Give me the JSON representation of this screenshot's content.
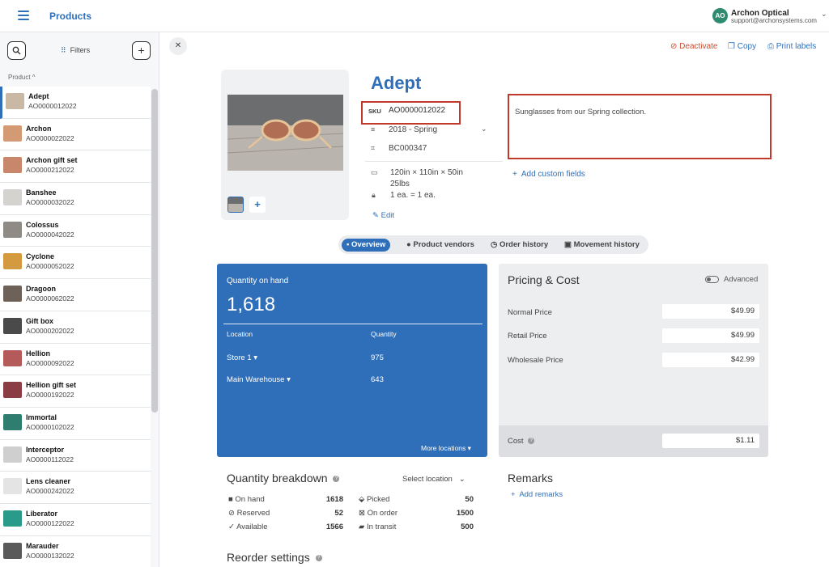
{
  "topbar": {
    "title": "Products",
    "avatar_initials": "AO",
    "company_name": "Archon Optical",
    "company_email": "support@archonsystems.com"
  },
  "sidebar": {
    "filters_label": "Filters",
    "sort_label": "Product ^",
    "items": [
      {
        "name": "Adept",
        "code": "AO0000012022",
        "thumb_color": "#c9b8a4"
      },
      {
        "name": "Archon",
        "code": "AO0000022022",
        "thumb_color": "#d49a74"
      },
      {
        "name": "Archon gift set",
        "code": "AO0000212022",
        "thumb_color": "#c8876a"
      },
      {
        "name": "Banshee",
        "code": "AO0000032022",
        "thumb_color": "#d5d3d0"
      },
      {
        "name": "Colossus",
        "code": "AO0000042022",
        "thumb_color": "#8e8a85"
      },
      {
        "name": "Cyclone",
        "code": "AO0000052022",
        "thumb_color": "#d49a40"
      },
      {
        "name": "Dragoon",
        "code": "AO0000062022",
        "thumb_color": "#6e6258"
      },
      {
        "name": "Gift box",
        "code": "AO0000202022",
        "thumb_color": "#4a4a4a"
      },
      {
        "name": "Hellion",
        "code": "AO0000092022",
        "thumb_color": "#b55a5a"
      },
      {
        "name": "Hellion gift set",
        "code": "AO0000192022",
        "thumb_color": "#8a3d45"
      },
      {
        "name": "Immortal",
        "code": "AO0000102022",
        "thumb_color": "#2e7d6f"
      },
      {
        "name": "Interceptor",
        "code": "AO0000112022",
        "thumb_color": "#cfcfcf"
      },
      {
        "name": "Lens cleaner",
        "code": "AO0000242022",
        "thumb_color": "#e4e4e4"
      },
      {
        "name": "Liberator",
        "code": "AO0000122022",
        "thumb_color": "#2a9a8a"
      },
      {
        "name": "Marauder",
        "code": "AO0000132022",
        "thumb_color": "#5a5a5a"
      }
    ]
  },
  "actions": {
    "deactivate": "Deactivate",
    "copy": "Copy",
    "print_labels": "Print labels"
  },
  "product": {
    "title": "Adept",
    "sku_label": "SKU",
    "sku": "AO0000012022",
    "season": "2018 - Spring",
    "barcode": "BC000347",
    "dimensions": "120in × 110in × 50in",
    "weight": "25lbs",
    "uom": "1 ea. = 1 ea.",
    "edit_label": "Edit",
    "description": "Sunglasses from our Spring collection.",
    "custom_fields_label": "Add custom fields"
  },
  "tabs": [
    {
      "label": "Overview",
      "icon": "overview-icon"
    },
    {
      "label": "Product vendors",
      "icon": "person-icon"
    },
    {
      "label": "Order history",
      "icon": "clock-icon"
    },
    {
      "label": "Movement history",
      "icon": "box-icon"
    }
  ],
  "quantity": {
    "label": "Quantity on hand",
    "total": "1,618",
    "col_location": "Location",
    "col_quantity": "Quantity",
    "rows": [
      {
        "location": "Store 1 ▾",
        "quantity": "975"
      },
      {
        "location": "Main Warehouse ▾",
        "quantity": "643"
      }
    ],
    "more_locations": "More locations ▾"
  },
  "pricing": {
    "title": "Pricing & Cost",
    "advanced_label": "Advanced",
    "rows": [
      {
        "label": "Normal Price",
        "value": "$49.99"
      },
      {
        "label": "Retail Price",
        "value": "$49.99"
      },
      {
        "label": "Wholesale Price",
        "value": "$42.99"
      }
    ],
    "cost_label": "Cost",
    "cost_value": "$1.11"
  },
  "breakdown": {
    "title": "Quantity breakdown",
    "select_label": "Select location",
    "left": [
      {
        "icon": "■",
        "label": "On hand",
        "value": "1618"
      },
      {
        "icon": "⊘",
        "label": "Reserved",
        "value": "52"
      },
      {
        "icon": "✓",
        "label": "Available",
        "value": "1566"
      }
    ],
    "right": [
      {
        "icon": "⬙",
        "label": "Picked",
        "value": "50"
      },
      {
        "icon": "⊠",
        "label": "On order",
        "value": "1500"
      },
      {
        "icon": "▰",
        "label": "In transit",
        "value": "500"
      }
    ]
  },
  "remarks": {
    "title": "Remarks",
    "add_label": "Add remarks"
  },
  "reorder": {
    "title": "Reorder settings"
  }
}
